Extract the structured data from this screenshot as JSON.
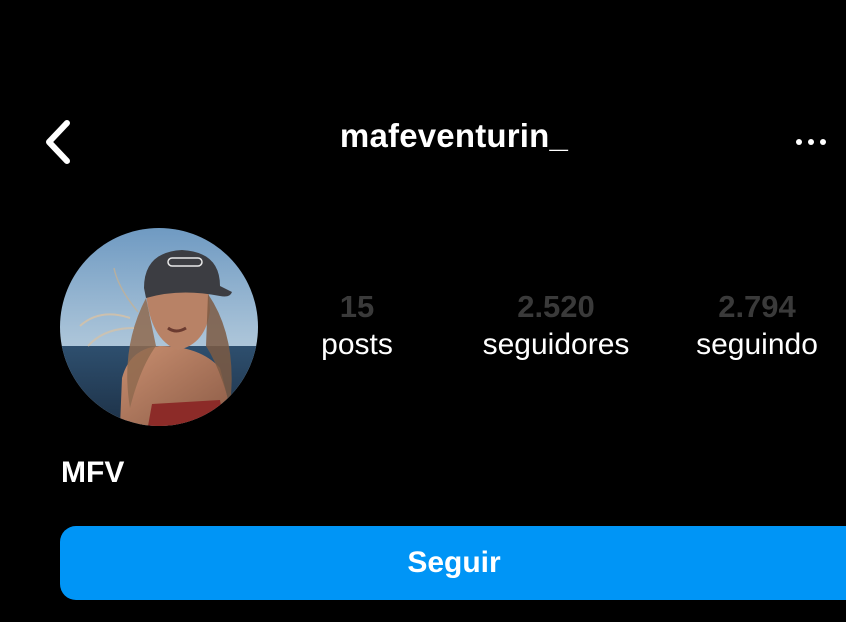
{
  "header": {
    "username": "mafeventurin_",
    "back_icon": "chevron-left-icon",
    "more_icon": "more-horizontal-icon"
  },
  "profile": {
    "avatar_icon": "profile-photo",
    "display_name": "MFV"
  },
  "stats": [
    {
      "value": "15",
      "label": "posts"
    },
    {
      "value": "2.520",
      "label": "seguidores"
    },
    {
      "value": "2.794",
      "label": "seguindo"
    }
  ],
  "actions": {
    "follow_label": "Seguir"
  },
  "colors": {
    "background": "#000000",
    "text": "#ffffff",
    "stat_number": "#3a3a3a",
    "accent": "#0095f6"
  }
}
